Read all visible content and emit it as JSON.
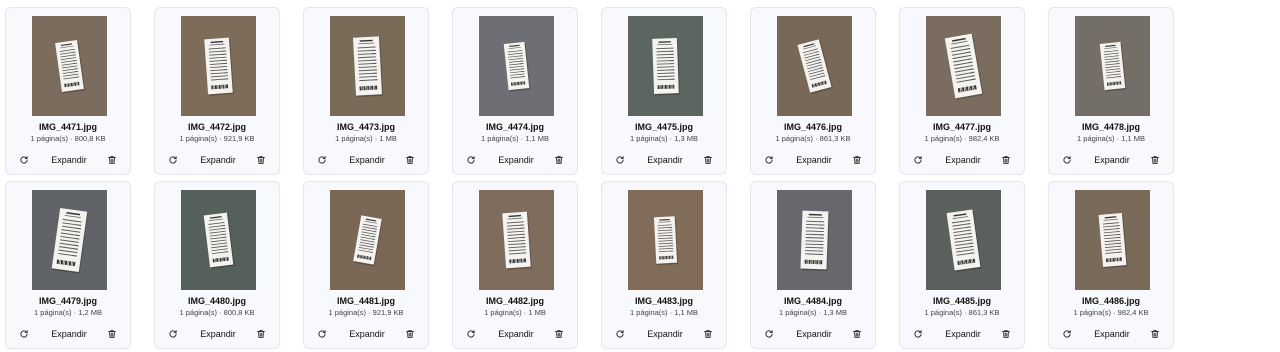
{
  "labels": {
    "expand": "Expandir"
  },
  "colors": {
    "card_bg": "#f8f9fc",
    "card_border": "#e3e6ec",
    "icon": "#333333"
  },
  "icons": {
    "rotate": "rotate-icon",
    "delete": "trash-icon"
  },
  "files": [
    {
      "name": "IMG_4471.jpg",
      "meta": "1 página(s) · 800,8 KB",
      "bg": "#7b6c5e"
    },
    {
      "name": "IMG_4472.jpg",
      "meta": "1 página(s) · 921,9 KB",
      "bg": "#7e6c5a"
    },
    {
      "name": "IMG_4473.jpg",
      "meta": "1 página(s) · 1 MB",
      "bg": "#7a6a58"
    },
    {
      "name": "IMG_4474.jpg",
      "meta": "1 página(s) · 1,1 MB",
      "bg": "#6d6f74"
    },
    {
      "name": "IMG_4475.jpg",
      "meta": "1 página(s) · 1,3 MB",
      "bg": "#5c6560"
    },
    {
      "name": "IMG_4476.jpg",
      "meta": "1 página(s) · 861,3 KB",
      "bg": "#786858"
    },
    {
      "name": "IMG_4477.jpg",
      "meta": "1 página(s) · 982,4 KB",
      "bg": "#7a6d5f"
    },
    {
      "name": "IMG_4478.jpg",
      "meta": "1 página(s) · 1,1 MB",
      "bg": "#7d6c58"
    },
    {
      "name": "IMG_4479.jpg",
      "meta": "1 página(s) · 1,2 MB",
      "bg": "#606469"
    },
    {
      "name": "IMG_4480.jpg",
      "meta": "1 página(s) · 800,8 KB",
      "bg": "#56605a"
    },
    {
      "name": "IMG_4481.jpg",
      "meta": "1 página(s) · 921,9 KB",
      "bg": "#7a6756"
    },
    {
      "name": "IMG_4482.jpg",
      "meta": "1 página(s) · 1 MB",
      "bg": "#7d6e60"
    },
    {
      "name": "IMG_4483.jpg",
      "meta": "1 página(s) · 1,1 MB",
      "bg": "#806c58"
    },
    {
      "name": "IMG_4484.jpg",
      "meta": "1 página(s) · 1,3 MB",
      "bg": "#66686d"
    },
    {
      "name": "IMG_4485.jpg",
      "meta": "1 página(s) · 861,3 KB",
      "bg": "#5a615d"
    },
    {
      "name": "IMG_4486.jpg",
      "meta": "1 página(s) · 982,4 KB",
      "bg": "#7a6a5a"
    }
  ]
}
